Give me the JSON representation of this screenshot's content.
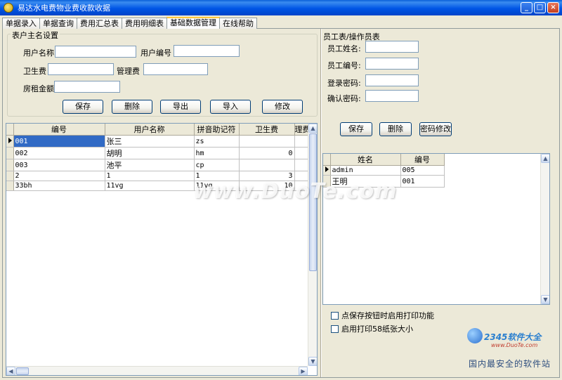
{
  "window": {
    "title": "易达水电费物业费收款收据",
    "minimize_label": "_",
    "maximize_label": "□",
    "close_label": "×"
  },
  "tabs": [
    {
      "label": "单据录入"
    },
    {
      "label": "单据查询"
    },
    {
      "label": "费用汇总表"
    },
    {
      "label": "费用明细表"
    },
    {
      "label": "基础数据管理",
      "active": true
    },
    {
      "label": "在线帮助"
    }
  ],
  "tenant_form": {
    "legend": "表户主名设置",
    "user_name_label": "用户名称",
    "user_name_value": "",
    "user_code_label": "用户编号",
    "user_code_value": "",
    "hygiene_fee_label": "卫生费",
    "hygiene_fee_value": "",
    "mgmt_fee_label": "管理费",
    "mgmt_fee_value": "",
    "rent_label": "房租金额",
    "rent_value": "",
    "buttons": {
      "save": "保存",
      "delete": "删除",
      "export": "导出",
      "import": "导入",
      "modify": "修改"
    }
  },
  "tenant_table": {
    "columns": [
      "编号",
      "用户名称",
      "拼音助记符",
      "卫生费",
      "理费"
    ],
    "rows": [
      {
        "code": "001",
        "name": "张三",
        "pinyin": "zs",
        "fee": ""
      },
      {
        "code": "002",
        "name": "胡明",
        "pinyin": "hm",
        "fee": "0"
      },
      {
        "code": "003",
        "name": "池平",
        "pinyin": "cp",
        "fee": ""
      },
      {
        "code": "2",
        "name": "1",
        "pinyin": "1",
        "fee": "3"
      },
      {
        "code": "33bh",
        "name": "11vg",
        "pinyin": "11vg",
        "fee": "10"
      }
    ]
  },
  "staff_form": {
    "legend": "员工表/操作员表",
    "staff_name_label": "员工姓名:",
    "staff_code_label": "员工编号:",
    "login_pwd_label": "登录密码:",
    "confirm_pwd_label": "确认密码:",
    "buttons": {
      "save": "保存",
      "delete": "删除",
      "change_pwd": "密码修改"
    }
  },
  "staff_table": {
    "columns": [
      "姓名",
      "编号"
    ],
    "rows": [
      {
        "name": "admin",
        "code": "005"
      },
      {
        "name": "王明",
        "code": "001"
      }
    ]
  },
  "options": {
    "print_on_save": "点保存按钮时启用打印功能",
    "print_58mm": "启用打印58纸张大小"
  },
  "watermark": {
    "text": "www.DuoTe.com"
  },
  "brand": {
    "logo_text": "2345软件大全",
    "site": "www.DuoTe.com",
    "slogan": "国内最安全的软件站"
  }
}
